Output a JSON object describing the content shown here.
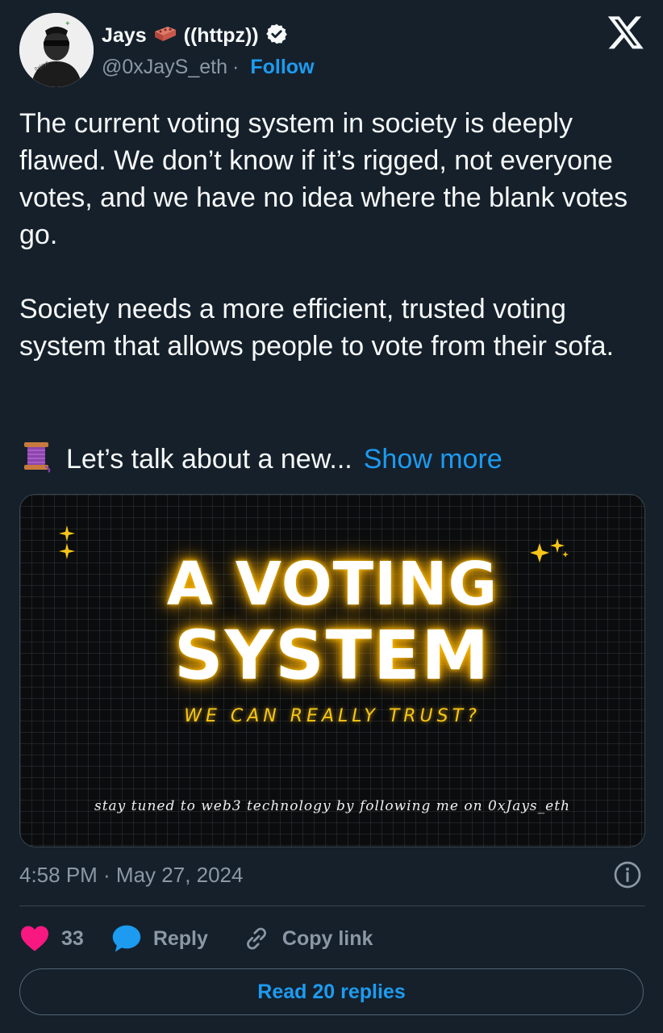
{
  "author": {
    "display_name": "Jays",
    "name_suffix": "((httpz))",
    "handle": "@0xJayS_eth",
    "separator": "·",
    "follow_label": "Follow",
    "verified": true
  },
  "tweet": {
    "text": "The current voting system in society is deeply flawed. We don’t know if it’s rigged, not everyone votes, and we have no idea where the blank votes go.\n\nSociety needs a more efficient, trusted voting system that allows people to vote from their sofa.",
    "teaser_emoji": "🧵",
    "teaser_text": "Let’s talk about a new...",
    "show_more_label": "Show more"
  },
  "media": {
    "title_line1": "A VOTING",
    "title_line2": "SYSTEM",
    "subtitle": "WE CAN REALLY TRUST?",
    "footer": "stay tuned to web3 technology by following me on 0xJays_eth"
  },
  "meta": {
    "timestamp": "4:58 PM · May 27, 2024"
  },
  "actions": {
    "like_count": "33",
    "reply_label": "Reply",
    "copy_link_label": "Copy link"
  },
  "read_replies_label": "Read 20 replies",
  "colors": {
    "background": "#15202b",
    "text": "#f7f9f9",
    "secondary": "#8b98a5",
    "accent": "#1d9bf0",
    "like": "#f91880",
    "glow": "#ffc000"
  },
  "icons": {
    "verified": "verified-badge-icon",
    "brick": "brick-emoji-icon",
    "x_logo": "x-logo-icon",
    "info": "info-icon",
    "heart": "heart-icon",
    "reply": "reply-bubble-icon",
    "link": "link-icon",
    "thread": "thread-spool-icon"
  }
}
